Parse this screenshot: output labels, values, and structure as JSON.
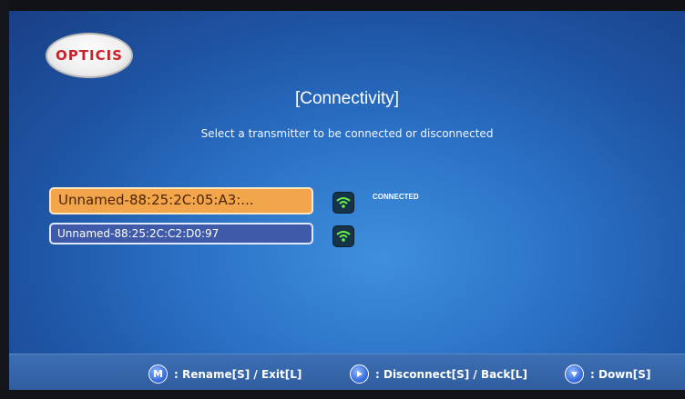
{
  "logo": {
    "text": "OPTICIS"
  },
  "header": {
    "title": "[Connectivity]",
    "subtitle": "Select a transmitter to be connected or disconnected"
  },
  "transmitters": [
    {
      "name": "Unnamed-88:25:2C:05:A3:...",
      "status": "CONNECTED",
      "icon": "wifi-icon"
    },
    {
      "name": "Unnamed-88:25:2C:C2:D0:97",
      "status": "",
      "icon": "wifi-icon"
    }
  ],
  "footer": {
    "hints": [
      {
        "key": "M",
        "label": ": Rename[S] / Exit[L]"
      },
      {
        "key": "right-arrow",
        "label": ": Disconnect[S] / Back[L]"
      },
      {
        "key": "down-arrow",
        "label": ": Down[S]"
      }
    ]
  },
  "colors": {
    "background": "#2b72c6",
    "selected_item": "#f3a54b",
    "normal_item": "#3e5aa8",
    "logo_red": "#c8222b"
  }
}
